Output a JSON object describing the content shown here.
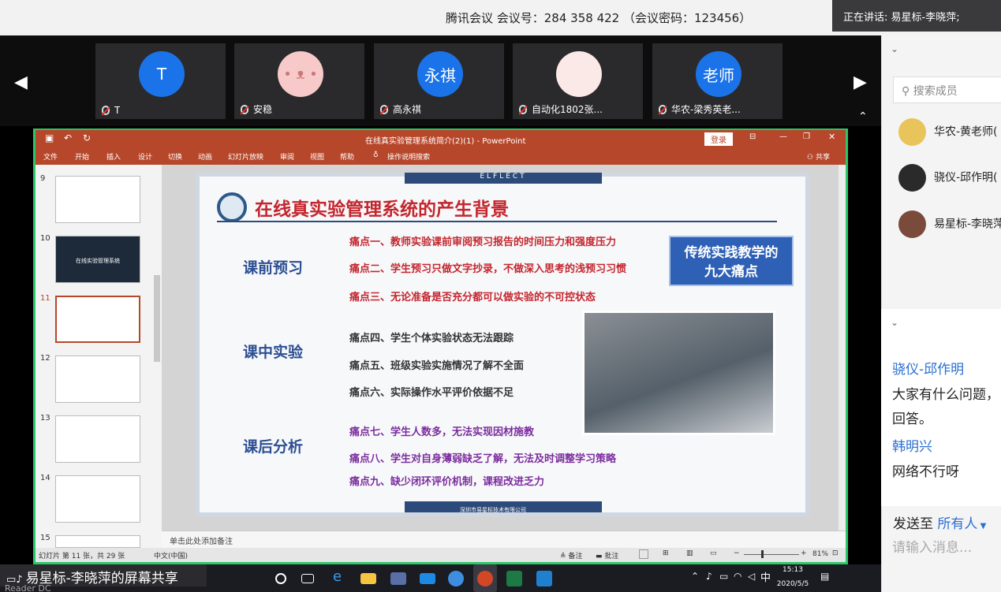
{
  "meeting": {
    "info": "腾讯会议 会议号：284 358 422 （会议密码：123456）",
    "speaking": "正在讲话: 易星标-李晓萍;"
  },
  "participants": [
    {
      "initial": "T",
      "name": "T",
      "color": "#1a73e8"
    },
    {
      "initial": "",
      "name": "安稳",
      "color": "#f7c9c9"
    },
    {
      "initial": "永祺",
      "name": "高永祺",
      "color": "#1a73e8"
    },
    {
      "initial": "",
      "name": "自动化1802张...",
      "color": "#fbe9e7"
    },
    {
      "initial": "老师",
      "name": "华农-梁秀英老...",
      "color": "#1a73e8"
    }
  ],
  "ppt": {
    "title": "在线真实验管理系统简介(2)(1) - PowerPoint",
    "login": "登录",
    "share": "共享",
    "tabs": [
      "文件",
      "开始",
      "插入",
      "设计",
      "切换",
      "动画",
      "幻灯片放映",
      "审阅",
      "视图",
      "帮助",
      "操作说明搜索"
    ],
    "slide_numbers": [
      "9",
      "10",
      "11",
      "12",
      "13",
      "14",
      "15"
    ],
    "thumb10_text": "在线实验管理系统",
    "notes": "单击此处添加备注",
    "status_left": "幻灯片 第 11 张，共 29 张",
    "status_lang": "中文(中国)",
    "status_notes": "备注",
    "status_comments": "批注",
    "zoom": "81%"
  },
  "slide": {
    "brand": "ELFLECT",
    "title": "在线真实验管理系统的产生背景",
    "sections": [
      "课前预习",
      "课中实验",
      "课后分析"
    ],
    "pains": [
      "痛点一、教师实验课前审阅预习报告的时间压力和强度压力",
      "痛点二、学生预习只做文字抄录，不做深入思考的浅预习习惯",
      "痛点三、无论准备是否充分都可以做实验的不可控状态",
      "痛点四、学生个体实验状态无法跟踪",
      "痛点五、班级实验实施情况了解不全面",
      "痛点六、实际操作水平评价依据不足",
      "痛点七、学生人数多，无法实现因材施教",
      "痛点八、学生对自身薄弱缺乏了解，无法及时调整学习策略",
      "痛点九、缺少闭环评价机制，课程改进乏力"
    ],
    "badge_line1": "传统实践教学的",
    "badge_line2": "九大痛点",
    "footer": "深圳市易星标技术有限公司",
    "colors": {
      "title": "#c4262e",
      "section": "#2c4f93",
      "pain_red": "#c4262e",
      "pain_dark": "#333333",
      "pain_purple": "#7b2d9e"
    }
  },
  "share_label": "易星标-李晓萍的屏幕共享",
  "reader": "Reader DC",
  "clock": {
    "time": "15:13",
    "date": "2020/5/5"
  },
  "tray_ime": "中",
  "panel": {
    "search_placeholder": "搜索成员",
    "members": [
      "华农-黄老师(",
      "骁仪-邱作明(",
      "易星标-李晓萍"
    ],
    "chat": [
      {
        "name": "骁仪-邱作明",
        "lines": [
          "大家有什么问题，",
          "回答。"
        ]
      },
      {
        "name": "韩明兴",
        "lines": [
          "网络不行呀"
        ]
      }
    ],
    "send_to_label": "发送至",
    "send_to_value": "所有人",
    "input_placeholder": "请输入消息..."
  }
}
